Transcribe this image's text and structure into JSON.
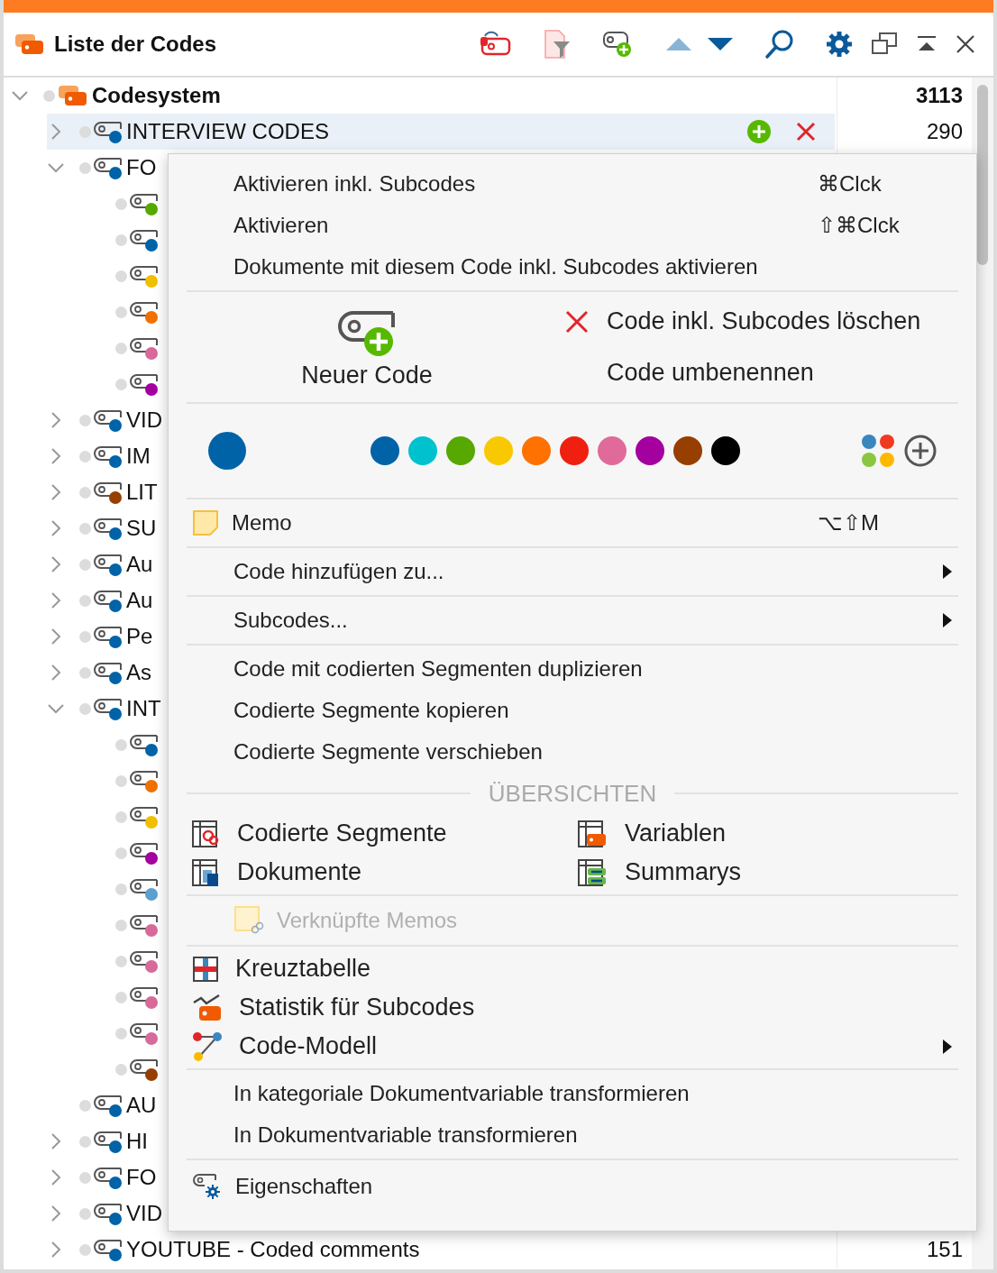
{
  "window": {
    "title": "Liste der Codes"
  },
  "tree": {
    "label": "Codesystem",
    "count": "3113",
    "expanded": true,
    "selected": false,
    "children": [
      {
        "label": "INTERVIEW CODES",
        "count": "290",
        "expanded": false,
        "selected": true,
        "color": "#0063a8"
      },
      {
        "label": "FO",
        "expanded": true,
        "selected": false,
        "color": "#0063a8",
        "children": [
          {
            "selected": false,
            "color": "#57a800"
          },
          {
            "selected": false,
            "color": "#0063a8"
          },
          {
            "selected": false,
            "color": "#f0c000"
          },
          {
            "selected": false,
            "color": "#f07000"
          },
          {
            "selected": false,
            "color": "#d86a9a"
          },
          {
            "selected": false,
            "color": "#a3009f"
          }
        ]
      },
      {
        "label": "VID",
        "expanded": false,
        "selected": false,
        "color": "#0063a8"
      },
      {
        "label": "IM",
        "expanded": false,
        "selected": false,
        "color": "#0063a8"
      },
      {
        "label": "LIT",
        "expanded": false,
        "selected": false,
        "color": "#963f00"
      },
      {
        "label": "SU",
        "expanded": false,
        "selected": false,
        "color": "#0063a8"
      },
      {
        "label": "Au",
        "expanded": false,
        "selected": false,
        "color": "#0063a8"
      },
      {
        "label": "Au",
        "expanded": false,
        "selected": false,
        "color": "#0063a8"
      },
      {
        "label": "Pe",
        "expanded": false,
        "selected": false,
        "color": "#0063a8"
      },
      {
        "label": "As",
        "expanded": false,
        "selected": false,
        "color": "#0063a8"
      },
      {
        "label": "INT",
        "expanded": true,
        "selected": false,
        "color": "#0063a8",
        "children": [
          {
            "selected": false,
            "color": "#0063a8"
          },
          {
            "selected": false,
            "color": "#f07000"
          },
          {
            "selected": false,
            "color": "#f0c000"
          },
          {
            "selected": false,
            "color": "#a3009f"
          },
          {
            "selected": false,
            "color": "#5aa0d0"
          },
          {
            "selected": false,
            "color": "#d86a9a"
          },
          {
            "selected": false,
            "color": "#d86a9a"
          },
          {
            "selected": false,
            "color": "#d86a9a"
          },
          {
            "selected": false,
            "color": "#d86a9a"
          },
          {
            "selected": false,
            "color": "#963f00"
          }
        ]
      },
      {
        "label": "AU",
        "selected": false,
        "color": "#0063a8"
      },
      {
        "label": "HI",
        "expanded": false,
        "selected": false,
        "color": "#0063a8"
      },
      {
        "label": "FO",
        "expanded": false,
        "selected": false,
        "color": "#0063a8"
      },
      {
        "label": "VID",
        "expanded": false,
        "selected": false,
        "color": "#0063a8"
      },
      {
        "label": "YOUTUBE - Coded comments",
        "count": "151",
        "expanded": false,
        "selected": false,
        "color": "#0063a8"
      }
    ]
  },
  "menu": {
    "activate_items": [
      {
        "label": "Aktivieren inkl. Subcodes",
        "shortcut": "⌘Clck"
      },
      {
        "label": "Aktivieren",
        "shortcut": "⇧⌘Clck"
      },
      {
        "label": "Dokumente mit diesem Code inkl. Subcodes aktivieren"
      }
    ],
    "new_code": "Neuer Code",
    "delete": "Code inkl. Subcodes löschen",
    "rename": "Code umbenennen",
    "current": {
      "color": "#0063a8"
    },
    "palette": [
      {
        "color": "#0063a8"
      },
      {
        "color": "#00c2cf"
      },
      {
        "color": "#57a800"
      },
      {
        "color": "#f8c900"
      },
      {
        "color": "#ff7100"
      },
      {
        "color": "#ef2010"
      },
      {
        "color": "#e06a9a"
      },
      {
        "color": "#a3009f"
      },
      {
        "color": "#963f00"
      },
      {
        "color": "#000000"
      }
    ],
    "memo": {
      "label": "Memo",
      "shortcut": "⌥⇧M"
    },
    "add_to": {
      "label": "Code hinzufügen zu...",
      "submenu": true
    },
    "subcodes": {
      "label": "Subcodes...",
      "submenu": true
    },
    "segment_actions": [
      "Code mit codierten Segmenten duplizieren",
      "Codierte Segmente kopieren",
      "Codierte Segmente verschieben"
    ],
    "overviews_header": "ÜBERSICHTEN",
    "overviews": [
      "Codierte Segmente",
      "Variablen",
      "Dokumente",
      "Summarys"
    ],
    "linked_memos": {
      "label": "Verknüpfte Memos",
      "disabled": true
    },
    "analysis": [
      {
        "label": "Kreuztabelle",
        "submenu": false
      },
      {
        "label": "Statistik für Subcodes",
        "submenu": false
      },
      {
        "label": "Code-Modell",
        "submenu": true
      }
    ],
    "transform": [
      "In kategoriale Dokumentvariable transformieren",
      "In Dokumentvariable transformieren"
    ],
    "properties": "Eigenschaften"
  }
}
